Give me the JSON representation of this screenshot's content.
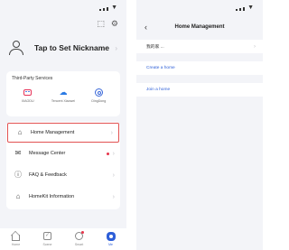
{
  "left_screen": {
    "top_actions": {
      "scan_icon": "scan-icon",
      "settings_icon": "gear-icon"
    },
    "profile": {
      "nickname_label": "Tap to Set Nickname"
    },
    "third_party": {
      "title": "Third-Party Services",
      "services": [
        {
          "label": "XIAODU",
          "icon": "xiaodu-icon"
        },
        {
          "label": "Tencent Xiaowei",
          "icon": "tencent-xiaowei-icon"
        },
        {
          "label": "DingDong",
          "icon": "dingdong-icon"
        }
      ]
    },
    "menu": [
      {
        "label": "Home Management",
        "icon": "home-icon"
      },
      {
        "label": "Message Center",
        "icon": "message-icon",
        "badge": true
      },
      {
        "label": "FAQ & Feedback",
        "icon": "help-icon"
      },
      {
        "label": "HomeKit Information",
        "icon": "homekit-icon"
      }
    ],
    "tabs": [
      {
        "label": "Home",
        "icon": "home-tab-icon"
      },
      {
        "label": "Scene",
        "icon": "scene-tab-icon"
      },
      {
        "label": "Smart",
        "icon": "smart-tab-icon"
      },
      {
        "label": "Me",
        "icon": "me-tab-icon",
        "active": true
      }
    ]
  },
  "right_screen": {
    "title": "Home Management",
    "homes": [
      {
        "label": "我的家 ..."
      }
    ],
    "create_home_label": "Create a home",
    "join_home_label": "Join a home"
  },
  "colors": {
    "accent": "#2e5fd8",
    "badge": "#e6344a",
    "highlight_border": "#e25252",
    "background": "#f3f4f8"
  }
}
